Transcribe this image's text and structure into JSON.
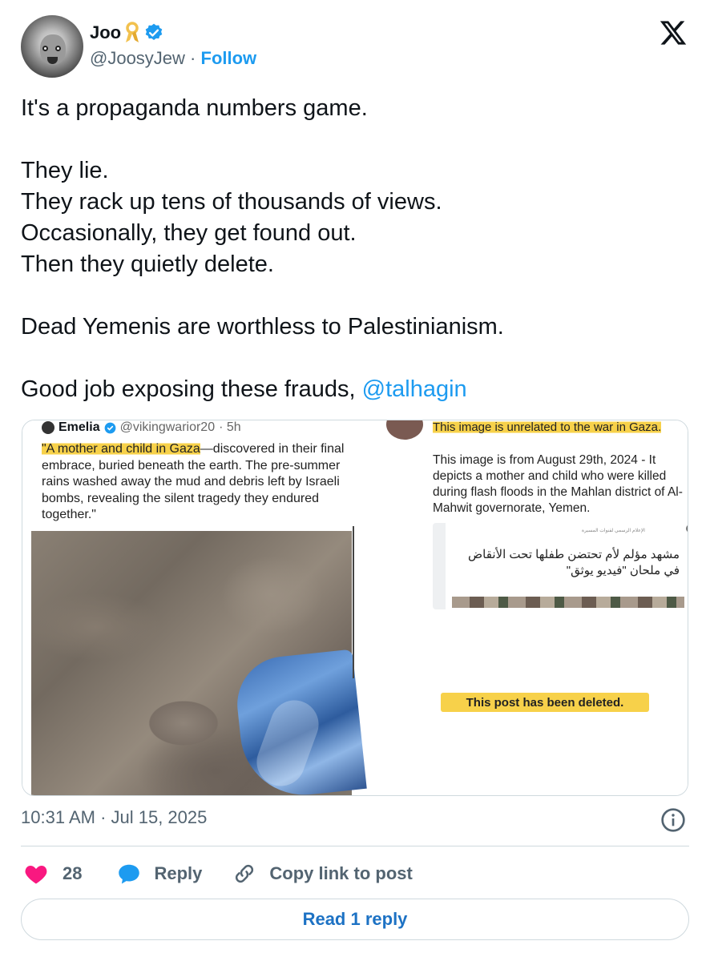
{
  "author": {
    "name": "Joo",
    "handle": "@JoosyJew",
    "separator": " · ",
    "follow_label": "Follow"
  },
  "tweet": {
    "text": "It's a propaganda numbers game.\n\nThey lie.\nThey rack up tens of thousands of views.\nOccasionally, they get found out.\nThen they quietly delete.\n\nDead Yemenis are worthless to Palestinianism.\n\nGood job exposing these frauds, ",
    "mention": "@talhagin"
  },
  "media": {
    "left": {
      "name": "Emelia",
      "handle": "@vikingwarior20",
      "time": "· 5h",
      "highlight": "\"A mother and child in Gaza",
      "body": "—discovered in their final embrace, buried beneath the earth. The pre-summer rains washed away the mud and debris left by Israeli bombs, revealing the silent tragedy they endured together.\""
    },
    "right": {
      "headline": "This image is unrelated to the war in Gaza.",
      "body": "This image is from August 29th, 2024 - It depicts a mother and child who were killed during flash floods in the Mahlan district of Al-Mahwit governorate, Yemen.",
      "embed_source": "الإعلام الرسمي لقنوات المسيرة",
      "embed_text": "مشهد مؤلم لأم تحتضن طفلها تحت الأنقاض في ملحان \"فيديو يوثق\"",
      "deleted": "This post has been deleted."
    }
  },
  "meta": {
    "timestamp": "10:31 AM · Jul 15, 2025"
  },
  "actions": {
    "like_count": "28",
    "reply_label": "Reply",
    "copy_label": "Copy link to post"
  },
  "read_reply_label": "Read 1 reply",
  "colors": {
    "link": "#1d9bf0",
    "like": "#f91880",
    "highlight": "#f7d14a",
    "muted": "#536471"
  }
}
